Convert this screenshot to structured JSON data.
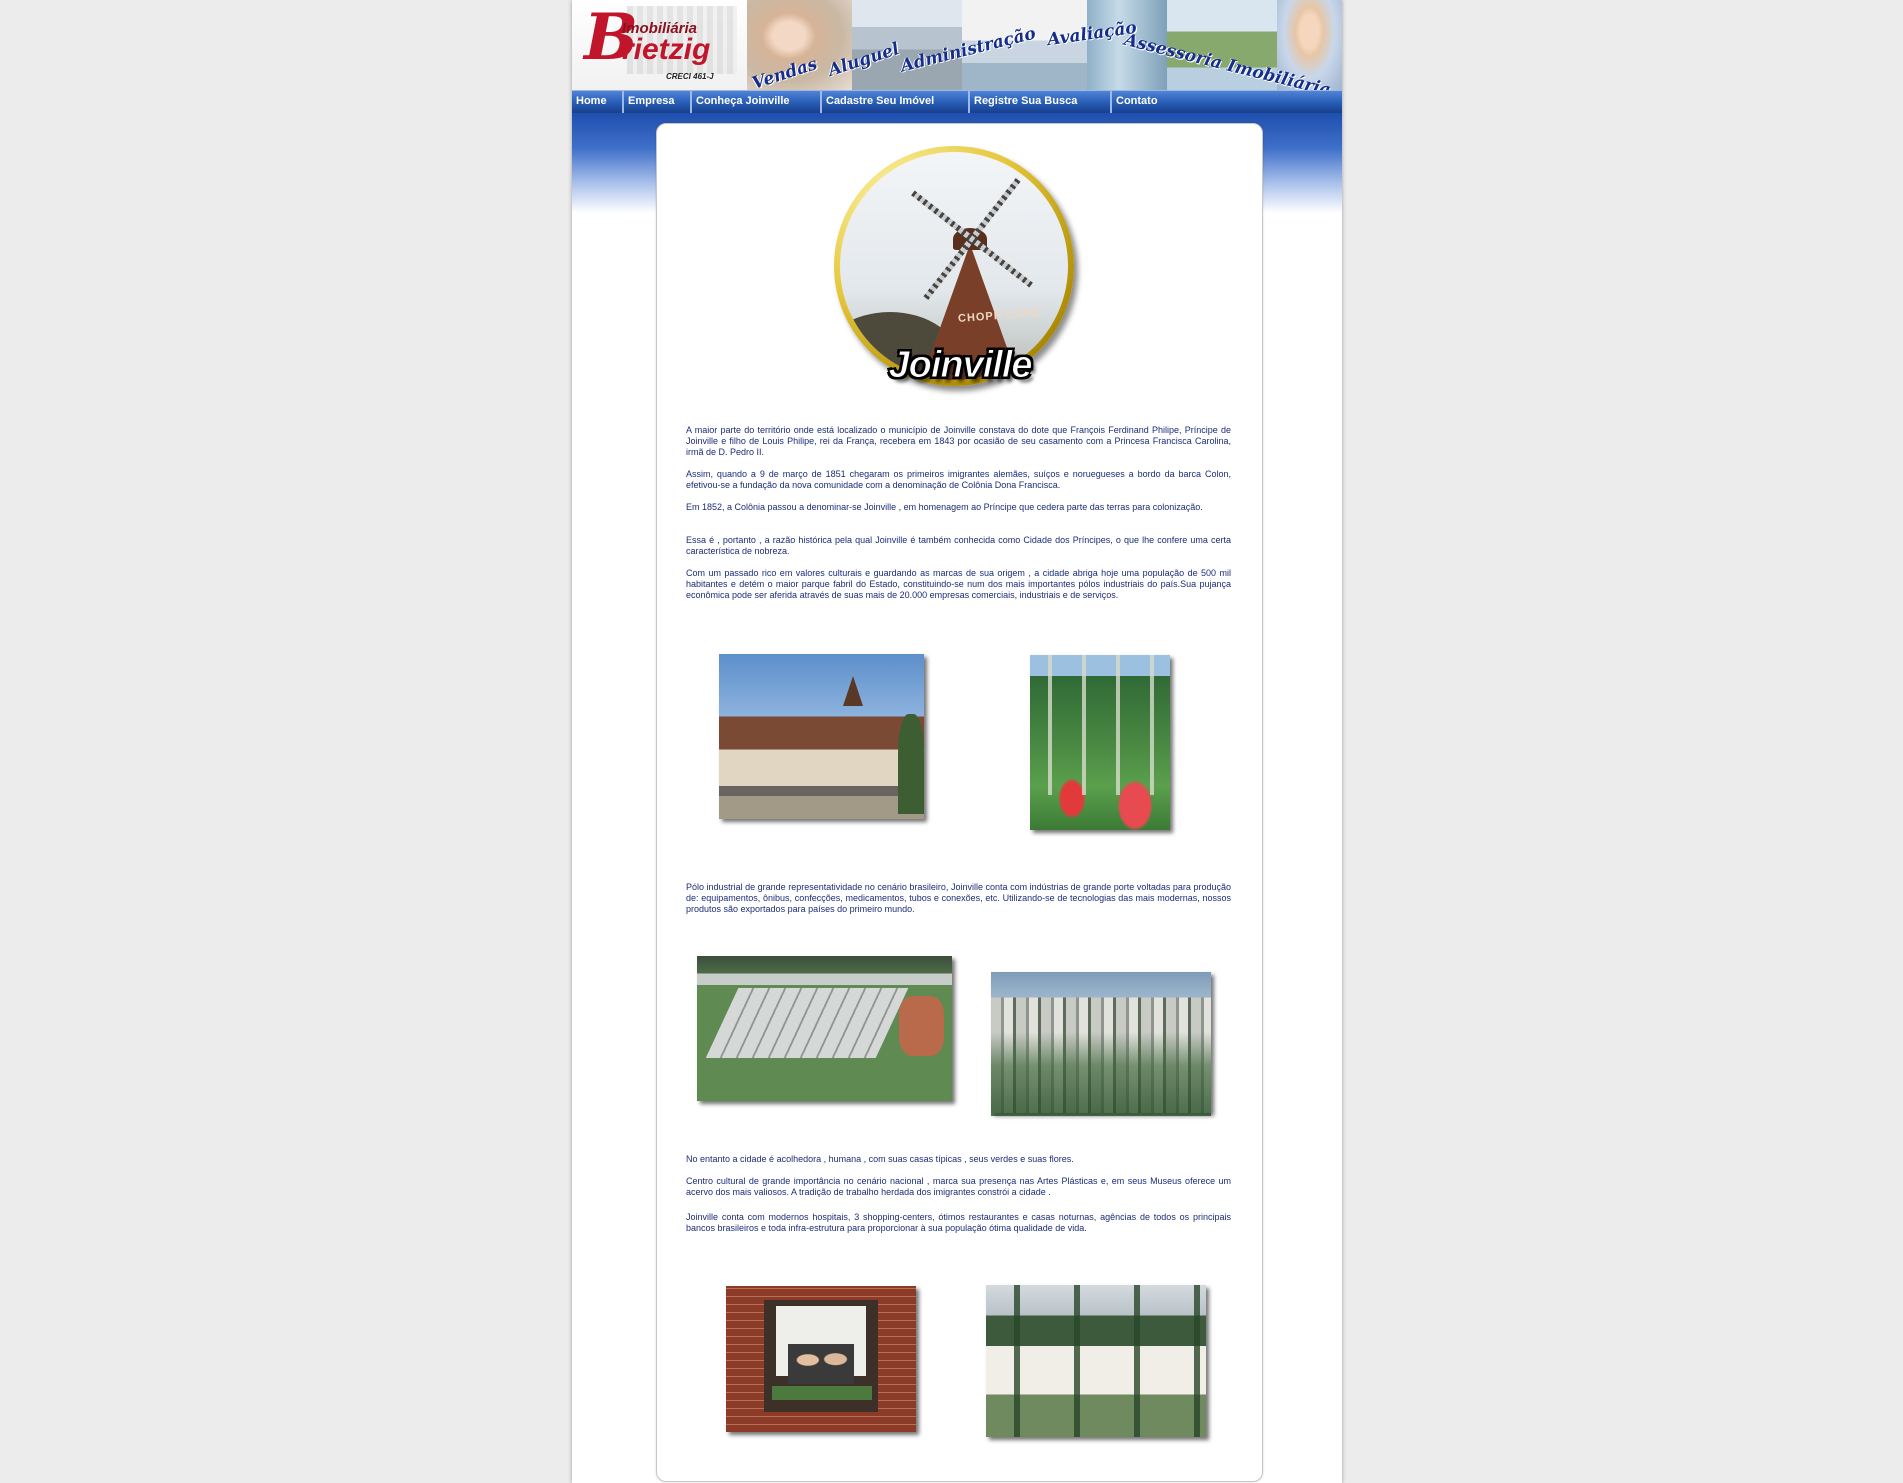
{
  "header": {
    "logo": {
      "initial": "B",
      "word1": "Imobiliária",
      "word2": "rietzig",
      "creci": "CRECI 461-J"
    },
    "slogans": [
      "Vendas",
      "Aluguel",
      "Administração",
      "Avaliação",
      "Assessoria Imobiliária"
    ]
  },
  "menu": {
    "items": [
      {
        "label": "Home"
      },
      {
        "label": "Empresa"
      },
      {
        "label": "Conheça Joinville"
      },
      {
        "label": "Cadastre Seu Imóvel"
      },
      {
        "label": "Registre Sua Busca"
      },
      {
        "label": "Contato"
      }
    ]
  },
  "hero": {
    "title": "Joinville",
    "sign": "CHOPP CAFÉ"
  },
  "content": {
    "paragraphs": [
      "A maior parte do território onde está localizado o município de Joinville constava do dote que François Ferdinand Philipe, Príncipe de Joinville e filho de Louis Philipe, rei da França, recebera em 1843 por ocasião de seu casamento com a Princesa Francisca Carolina, irmã de D. Pedro II.",
      "Assim, quando a 9 de março de 1851 chegaram os primeiros imigrantes alemães, suíços e noruegueses a bordo da barca Colon, efetivou-se a fundação da nova comunidade com a denominação de Colônia Dona Francisca.",
      "Em 1852, a Colônia passou a denominar-se Joinville , em homenagem ao Príncipe que cedera parte das terras para colonização.",
      "Essa é , portanto , a razão histórica pela qual Joinville é também conhecida como Cidade dos Príncipes, o que lhe confere uma certa característica de nobreza.",
      "Com um passado rico em valores culturais e guardando as marcas de sua origem , a cidade abriga hoje uma população de 500 mil habitantes e detém o maior parque fabril do Estado, constituindo-se num dos mais importantes pólos industriais do país.Sua pujança econômica pode ser aferida através de suas mais de 20.000 empresas comerciais, industriais e de serviços.",
      "Pólo industrial de grande representatividade no cenário brasileiro, Joinville conta com indústrias de grande porte voltadas para produção de: equipamentos, ônibus, confecções, medicamentos, tubos e conexões, etc. Utilizando-se de tecnologias das mais modernas, nossos produtos são exportados para países do primeiro mundo.",
      "No entanto a cidade é acolhedora , humana , com suas casas típicas , seus verdes e suas flores.",
      "Centro cultural de grande importância no cenário nacional , marca sua presença nas Artes Plásticas e, em seus Museus oferece um acervo dos mais valiosos. A tradição de trabalho herdada dos imigrantes constrói a cidade .",
      "Joinville conta com modernos hospitais, 3 shopping-centers, ótimos restaurantes e casas noturnas, agências de todos os principais bancos brasileiros e toda infra-estrutura para proporcionar à sua população ótima qualidade de vida."
    ]
  },
  "colors": {
    "menu_bar": "#2a5fb8",
    "text": "#1b2c78",
    "brand_red": "#c0152a",
    "slogan_blue": "#152e8c"
  }
}
